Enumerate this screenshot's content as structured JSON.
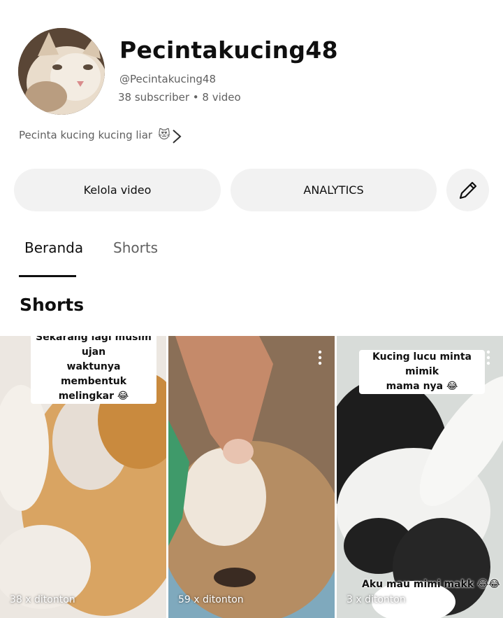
{
  "channel": {
    "name": "Pecintakucing48",
    "handle": "@Pecintakucing48",
    "stats": "38 subscriber • 8 video",
    "description": "Pecinta kucing kucing liar",
    "description_emoji": "😻"
  },
  "actions": {
    "manage_label": "Kelola video",
    "analytics_label": "ANALYTICS",
    "edit_icon": "pencil-icon"
  },
  "tabs": [
    {
      "label": "Beranda",
      "selected": true
    },
    {
      "label": "Shorts",
      "selected": false
    }
  ],
  "section_title": "Shorts",
  "shorts": [
    {
      "caption": "Sekarang lagi musim ujan waktunya membentuk melingkar 😂",
      "caption_lines": [
        "Sekarang lagi musim ujan",
        "waktunya membentuk",
        "melingkar 😂"
      ],
      "views": "38 x ditonton"
    },
    {
      "caption": "",
      "views": "59 x ditonton"
    },
    {
      "caption": "Kucing lucu minta mimik mama nya 😂",
      "caption_lines": [
        "Kucing lucu minta mimik",
        "mama nya 😂"
      ],
      "overlay": "Aku mau mimi makk 😂😂",
      "views": "3 x ditonton"
    }
  ],
  "colors": {
    "primary_text": "#0f0f0f",
    "secondary_text": "#606060",
    "button_bg": "#f2f2f2"
  }
}
